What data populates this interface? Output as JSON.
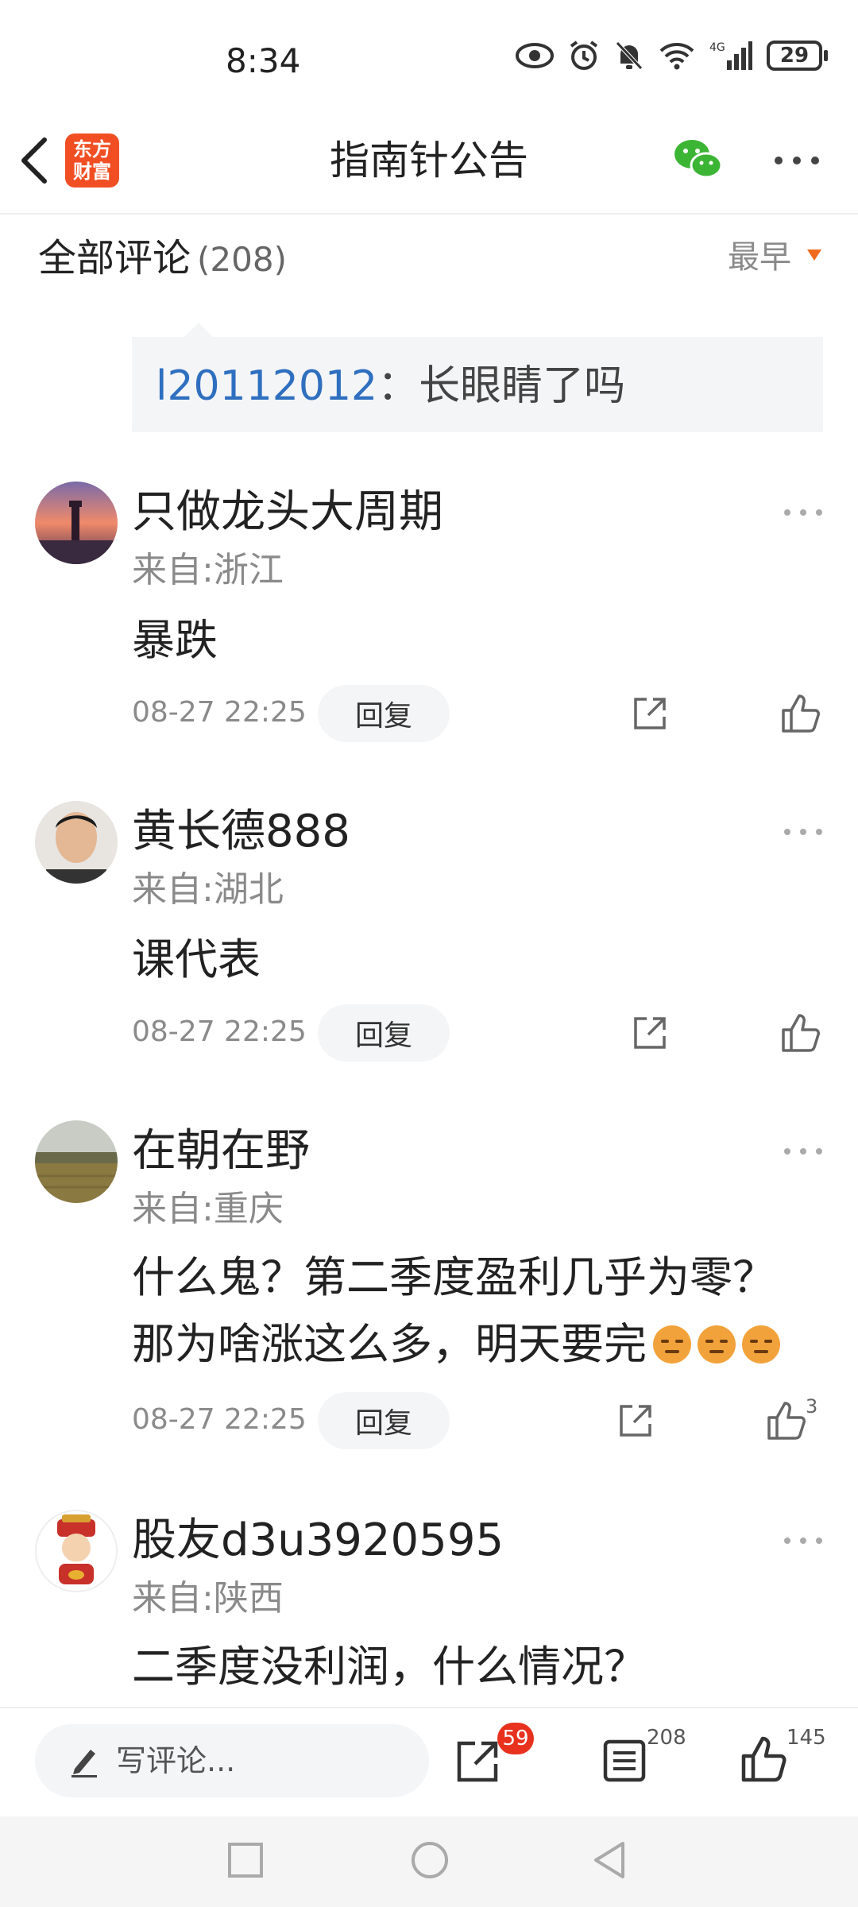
{
  "status_bar": {
    "time": "8:34",
    "battery": "29",
    "network": "4G"
  },
  "nav": {
    "logo_line1": "东方",
    "logo_line2": "财富",
    "title": "指南针公告",
    "icons": [
      "back-icon",
      "wechat-icon",
      "more-icon"
    ]
  },
  "comments_header": {
    "label": "全部评论",
    "count": "(208)",
    "sort": "最早"
  },
  "quoted_reply": {
    "user": "l20112012",
    "text": "：长眼睛了吗"
  },
  "comments": [
    {
      "name": "只做龙头大周期",
      "location": "来自:浙江",
      "text": "暴跌",
      "time": "08-27 22:25",
      "reply": "回复",
      "likes": ""
    },
    {
      "name": "黄长德888",
      "location": "来自:湖北",
      "text": "课代表",
      "time": "08-27 22:25",
      "reply": "回复",
      "likes": ""
    },
    {
      "name": "在朝在野",
      "location": "来自:重庆",
      "text_line1": "什么鬼？第二季度盈利几乎为零？",
      "text_line2": "那为啥涨这么多，明天要完",
      "time": "08-27 22:25",
      "reply": "回复",
      "likes": "3"
    },
    {
      "name": "股友d3u3920595",
      "location": "来自:陕西",
      "text": "二季度没利润，什么情况？"
    }
  ],
  "bottom_bar": {
    "compose_placeholder": "写评论...",
    "share_badge": "59",
    "comment_count": "208",
    "like_count": "145"
  },
  "colors": {
    "brand": "#f14f23",
    "link": "#2f6fbf",
    "badge": "#e8321e",
    "sort_arrow": "#f06a1d"
  }
}
